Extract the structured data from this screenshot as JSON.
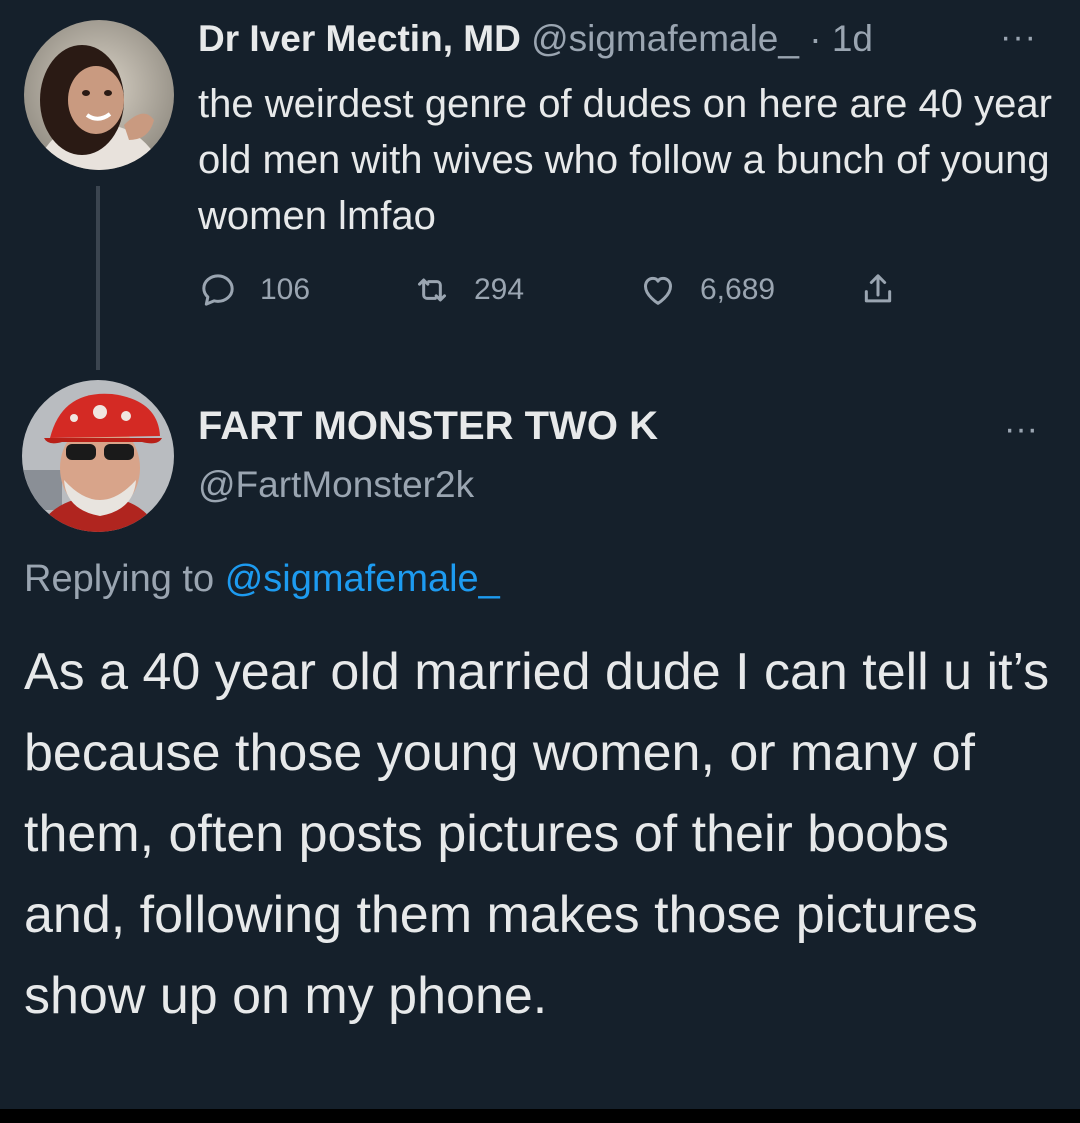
{
  "tweet1": {
    "display_name": "Dr Iver Mectin, MD",
    "handle": "@sigmafemale_",
    "separator": "·",
    "time": "1d",
    "more": "···",
    "text": "the weirdest genre of dudes on here are 40 year old men with wives who follow a bunch of young women lmfao",
    "replies": "106",
    "retweets": "294",
    "likes": "6,689",
    "icons": [
      "reply-icon",
      "retweet-icon",
      "like-icon",
      "share-icon"
    ]
  },
  "tweet2": {
    "display_name": "FART MONSTER TWO K",
    "handle": "@FartMonster2k",
    "more": "···",
    "replying_prefix": "Replying to",
    "replying_handle": "@sigmafemale_",
    "text": "As a 40 year old married dude I can tell u it’s because those young women, or many of them, often posts pictures of their boobs and, following them makes those pictures show up on my phone."
  },
  "colors": {
    "background": "#15202b",
    "text": "#e7e9ea",
    "muted": "#9aa5b1",
    "link": "#1d9bf0"
  }
}
